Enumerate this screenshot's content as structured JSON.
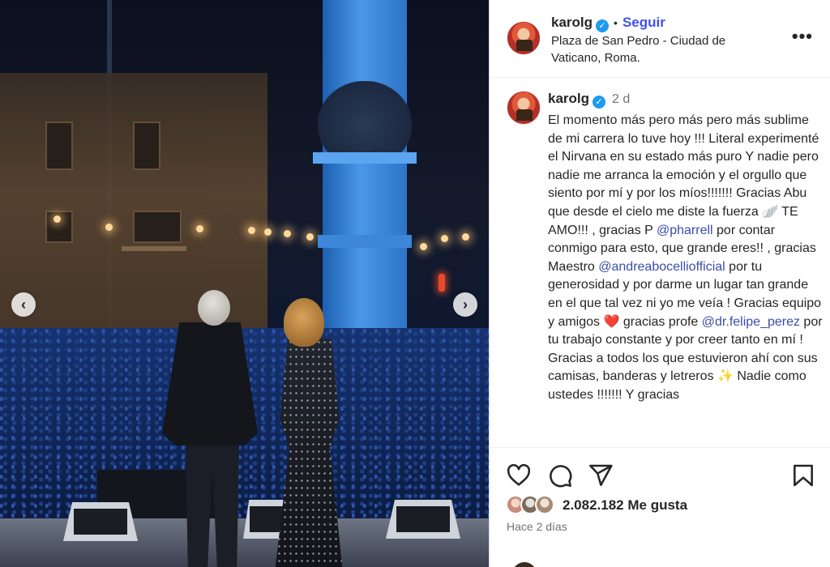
{
  "post": {
    "username": "karolg",
    "verified_icon": "verified-badge-icon",
    "separator": "•",
    "follow_label": "Seguir",
    "location": "Plaza de San Pedro - Ciudad de Vaticano, Roma.",
    "more_label": "•••"
  },
  "photo": {
    "prev_icon": "‹",
    "next_icon": "›"
  },
  "comment": {
    "username": "karolg",
    "time": "2 d",
    "caption": {
      "p1": "El momento más pero más pero más sublime de mi carrera lo tuve hoy !!! Literal experimenté el Nirvana en su estado más puro  Y nadie pero nadie me arranca la emoción y el orgullo que siento por mí y por los míos!!!!!!! Gracias Abu que desde el cielo me diste la fuerza 🪽 TE AMO!!! , gracias P ",
      "m1": "@pharrell",
      "p2": " por contar conmigo para esto, que grande eres!! , gracias Maestro ",
      "m2": "@andreabocelliofficial",
      "p3": " por tu generosidad y por darme un lugar tan grande en el que tal vez ni yo me veía ! Gracias equipo y amigos ❤️ gracias profe ",
      "m3": "@dr.felipe_perez",
      "p4": " por tu trabajo constante y por creer tanto en mí ! Gracias a todos los que estuvieron ahí con sus camisas, banderas y letreros ✨ Nadie como ustedes !!!!!!! Y gracias"
    }
  },
  "actions": {
    "like_icon": "heart-icon",
    "comment_icon": "comment-bubble-icon",
    "share_icon": "paper-plane-icon",
    "save_icon": "bookmark-icon",
    "likes_text": "2.082.182 Me gusta",
    "time_ago": "Hace 2 días"
  },
  "colors": {
    "link": "#4150f7",
    "mention": "#3a4dab",
    "verified": "#1d9bf0",
    "muted": "#737373"
  }
}
